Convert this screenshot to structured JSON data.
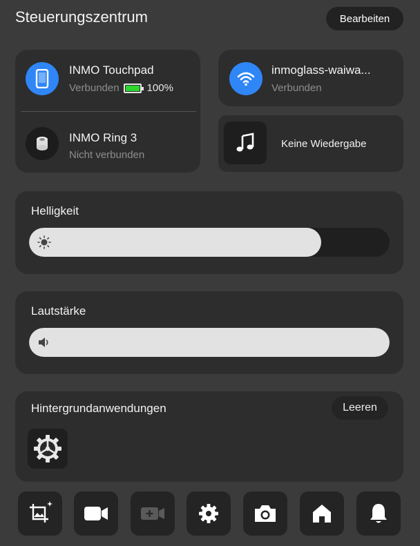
{
  "header": {
    "title": "Steuerungszentrum",
    "edit_label": "Bearbeiten"
  },
  "devices": [
    {
      "name": "INMO Touchpad",
      "status": "Verbunden",
      "battery": "100%",
      "icon": "tablet-icon",
      "color": "#2f86f6"
    },
    {
      "name": "INMO Ring 3",
      "status": "Nicht verbunden",
      "icon": "ring-icon",
      "color": "#1c1c1c"
    }
  ],
  "wifi": {
    "name": "inmoglass-waiwa...",
    "status": "Verbunden",
    "icon": "wifi-icon",
    "color": "#2f86f6"
  },
  "media": {
    "label": "Keine Wiedergabe",
    "icon": "music-note-icon"
  },
  "brightness": {
    "label": "Helligkeit",
    "level_percent": 81,
    "icon": "sun-icon"
  },
  "volume": {
    "label": "Lautstärke",
    "level_percent": 100,
    "icon": "speaker-icon"
  },
  "background_apps": {
    "label": "Hintergrundanwendungen",
    "clear_label": "Leeren",
    "apps": [
      {
        "icon": "settings-gear-icon"
      }
    ]
  },
  "toolbar": [
    {
      "icon": "screenshot-icon"
    },
    {
      "icon": "video-camera-icon"
    },
    {
      "icon": "record-video-icon",
      "disabled": true
    },
    {
      "icon": "gear-icon"
    },
    {
      "icon": "camera-icon"
    },
    {
      "icon": "home-icon"
    },
    {
      "icon": "bell-icon"
    }
  ]
}
